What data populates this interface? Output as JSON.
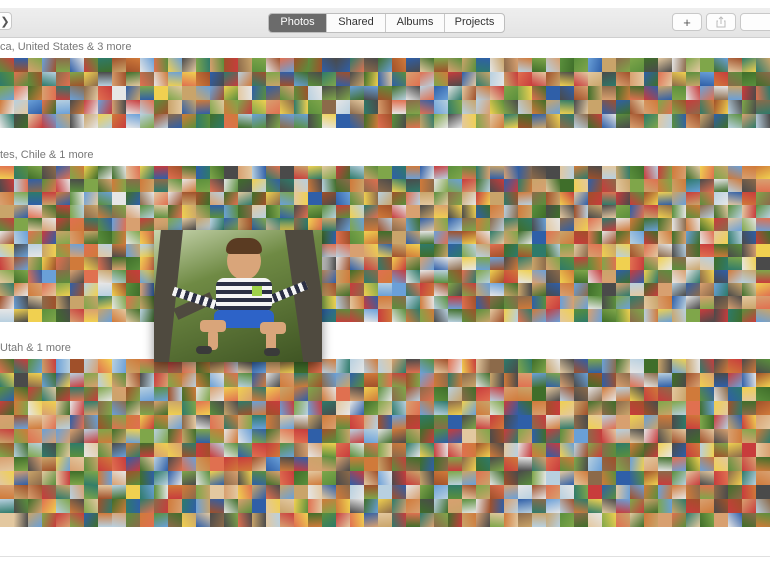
{
  "toolbar": {
    "back_icon": "chevron-left-icon",
    "tabs": [
      {
        "label": "Photos",
        "active": true
      },
      {
        "label": "Shared",
        "active": false
      },
      {
        "label": "Albums",
        "active": false
      },
      {
        "label": "Projects",
        "active": false
      }
    ],
    "add_icon": "plus-icon",
    "share_icon": "share-icon"
  },
  "moments": [
    {
      "title": "ca, United States & 3 more"
    },
    {
      "title": "tes, Chile & 1 more"
    },
    {
      "title": "Utah & 1 more"
    }
  ],
  "preview": {
    "description_icon": "photo-preview"
  },
  "colors": {
    "active_tab": "#6b6b6b",
    "toolbar_bg": "#e9e9e9"
  }
}
